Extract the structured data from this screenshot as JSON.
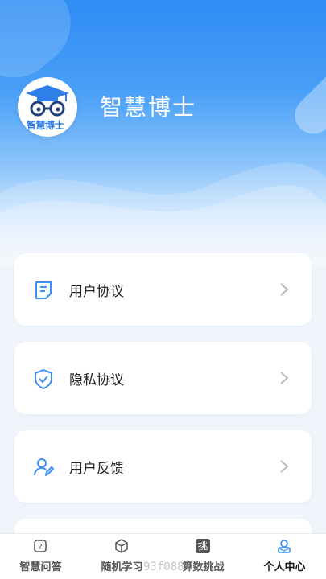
{
  "app": {
    "name": "智慧博士",
    "logo_text": "智慧博士"
  },
  "menu": [
    {
      "label": "用户协议",
      "icon": "document-icon"
    },
    {
      "label": "隐私协议",
      "icon": "shield-check-icon"
    },
    {
      "label": "用户反馈",
      "icon": "user-edit-icon"
    }
  ],
  "tabs": [
    {
      "label": "智慧问答",
      "icon": "qa-icon",
      "active": false
    },
    {
      "label": "随机学习",
      "icon": "cube-icon",
      "active": false
    },
    {
      "label": "算数挑战",
      "icon": "challenge-icon",
      "icon_text": "挑",
      "active": false
    },
    {
      "label": "个人中心",
      "icon": "profile-icon",
      "active": true
    }
  ],
  "watermark": "93f088",
  "colors": {
    "primary": "#2f8cf5",
    "icon_blue": "#3b8ff5",
    "background": "#f1f5fb"
  }
}
